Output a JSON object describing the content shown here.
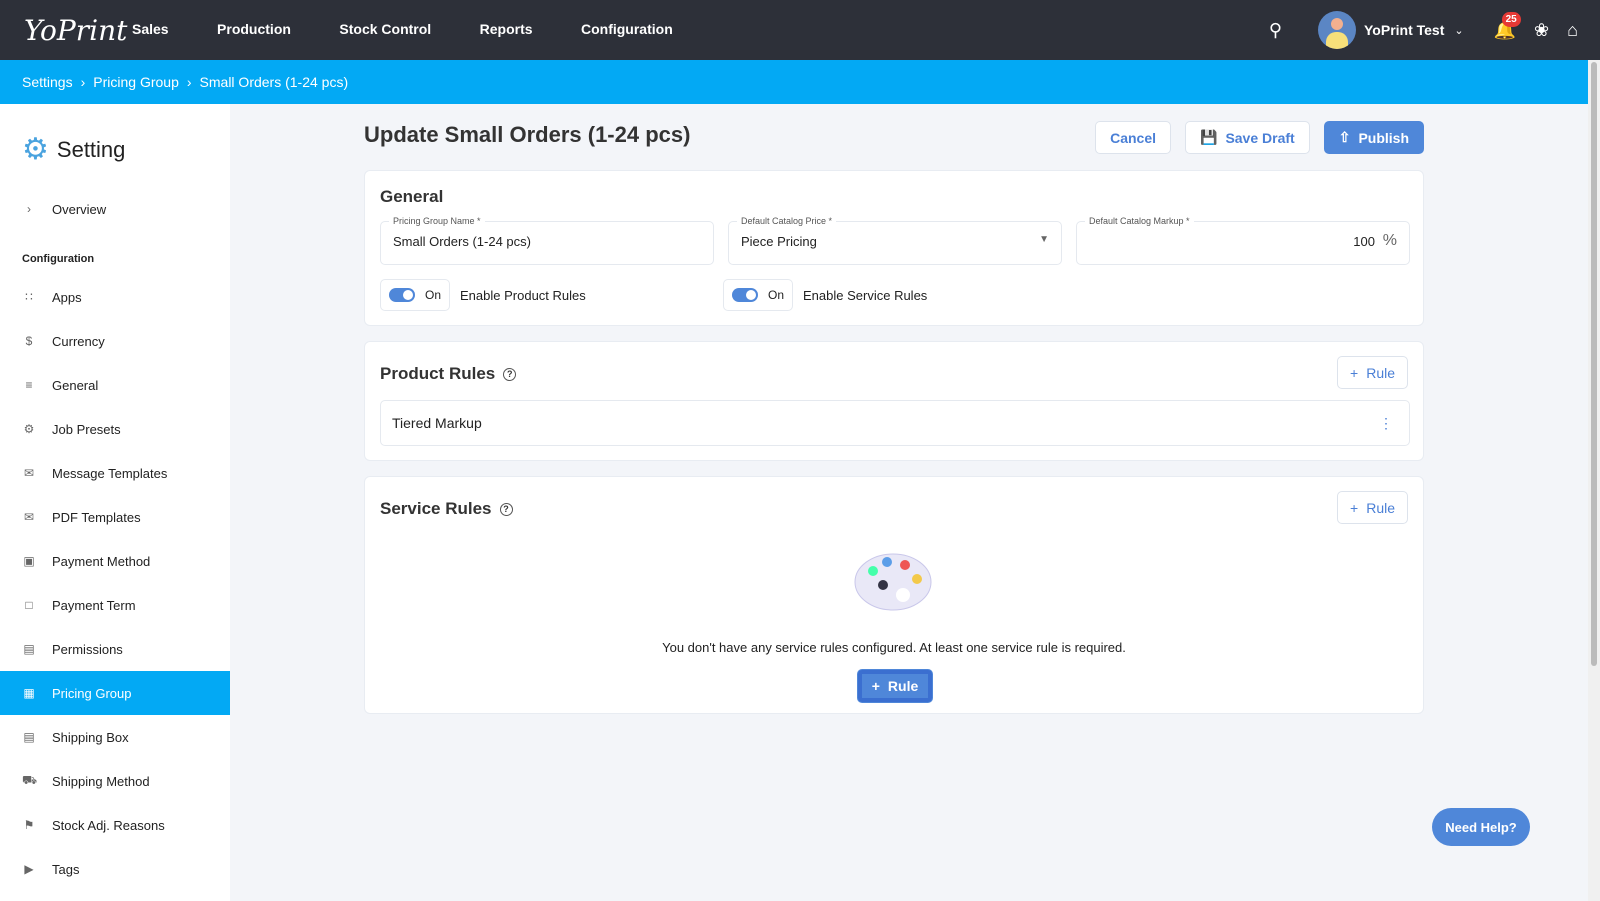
{
  "nav": {
    "logo": "YoPrint",
    "items": [
      "Sales",
      "Production",
      "Stock Control",
      "Reports",
      "Configuration"
    ],
    "user": "YoPrint Test",
    "notifications": "25"
  },
  "breadcrumb": [
    "Settings",
    "Pricing Group",
    "Small Orders (1-24 pcs)"
  ],
  "sidebar": {
    "title": "Setting",
    "overview": "Overview",
    "section": "Configuration",
    "items": [
      "Apps",
      "Currency",
      "General",
      "Job Presets",
      "Message Templates",
      "PDF Templates",
      "Payment Method",
      "Payment Term",
      "Permissions",
      "Pricing Group",
      "Shipping Box",
      "Shipping Method",
      "Stock Adj. Reasons",
      "Tags"
    ],
    "active": "Pricing Group"
  },
  "page": {
    "title": "Update Small Orders (1-24 pcs)",
    "cancel": "Cancel",
    "save_draft": "Save Draft",
    "publish": "Publish"
  },
  "general": {
    "title": "General",
    "name_label": "Pricing Group Name *",
    "name_value": "Small Orders (1-24 pcs)",
    "price_label": "Default Catalog Price *",
    "price_value": "Piece Pricing",
    "markup_label": "Default Catalog Markup *",
    "markup_value": "100",
    "markup_unit": "%",
    "toggle_on": "On",
    "product_rules_toggle": "Enable Product Rules",
    "service_rules_toggle": "Enable Service Rules"
  },
  "product_rules": {
    "title": "Product Rules",
    "add": "Rule",
    "rules": [
      "Tiered Markup"
    ]
  },
  "service_rules": {
    "title": "Service Rules",
    "add": "Rule",
    "empty": "You don't have any service rules configured. At least one service rule is required.",
    "empty_add": "Rule"
  },
  "help": "Need Help?"
}
